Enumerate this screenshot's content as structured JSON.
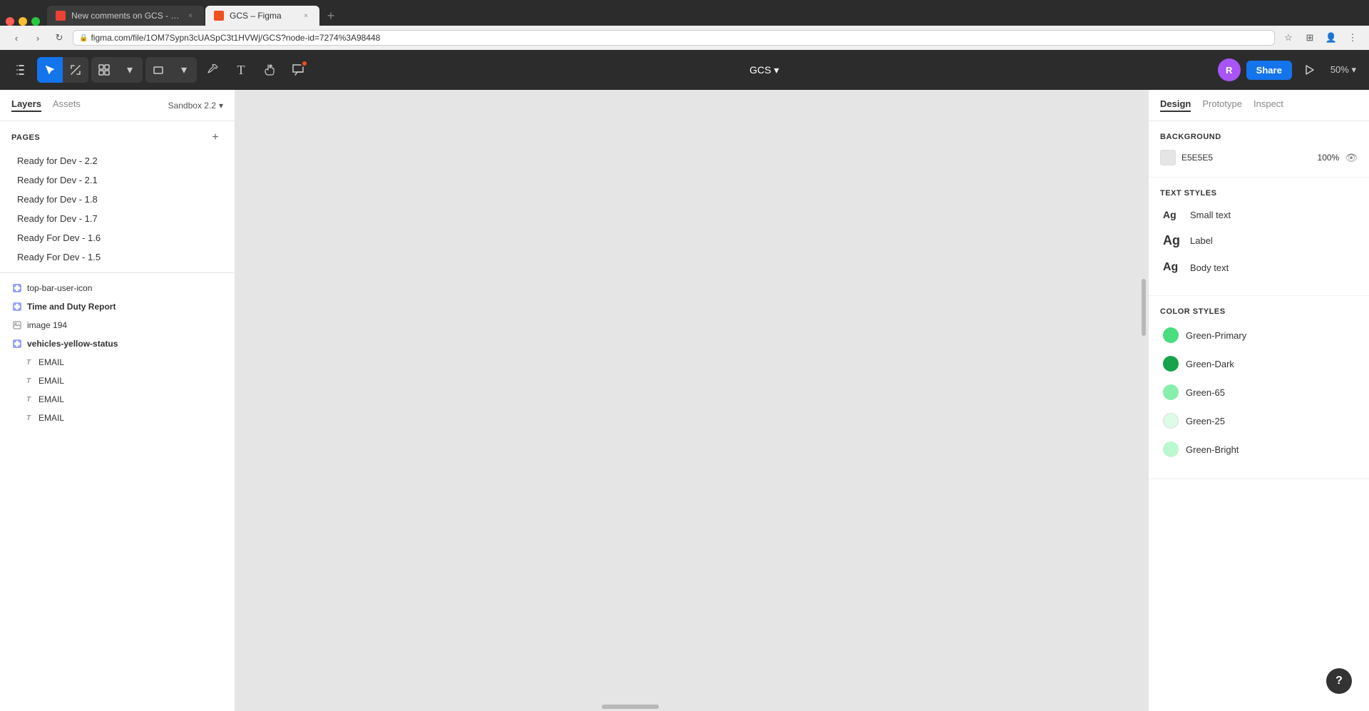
{
  "browser": {
    "tabs": [
      {
        "id": "gmail",
        "favicon_type": "gmail",
        "title": "New comments on GCS - ruth...",
        "active": false,
        "closeable": true
      },
      {
        "id": "figma",
        "favicon_type": "figma",
        "title": "GCS – Figma",
        "active": true,
        "closeable": true
      }
    ],
    "address": "figma.com/file/1OM7Sypn3cUASpC3t1HVWj/GCS?node-id=7274%3A98448",
    "address_lock": "🔒"
  },
  "toolbar": {
    "menu_icon": "≡",
    "project_name": "GCS",
    "chevron": "▾",
    "share_label": "Share",
    "zoom": "50%",
    "avatar_initials": "R",
    "notification_count": "1"
  },
  "left_panel": {
    "tabs": [
      {
        "id": "layers",
        "label": "Layers",
        "active": true
      },
      {
        "id": "assets",
        "label": "Assets",
        "active": false
      }
    ],
    "sandbox_label": "Sandbox 2.2",
    "pages_title": "Pages",
    "pages": [
      {
        "id": "p1",
        "label": "Ready for Dev - 2.2"
      },
      {
        "id": "p2",
        "label": "Ready for Dev - 2.1"
      },
      {
        "id": "p3",
        "label": "Ready for Dev - 1.8"
      },
      {
        "id": "p4",
        "label": "Ready for Dev - 1.7"
      },
      {
        "id": "p5",
        "label": "Ready For Dev - 1.6"
      },
      {
        "id": "p6",
        "label": "Ready For Dev - 1.5"
      }
    ],
    "layers": [
      {
        "id": "l1",
        "icon": "frame",
        "name": "top-bar-user-icon",
        "indent": false,
        "bold": false
      },
      {
        "id": "l2",
        "icon": "frame",
        "name": "Time and Duty Report",
        "indent": false,
        "bold": true
      },
      {
        "id": "l3",
        "icon": "image",
        "name": "image 194",
        "indent": false,
        "bold": false
      },
      {
        "id": "l4",
        "icon": "frame",
        "name": "vehicles-yellow-status",
        "indent": false,
        "bold": true
      },
      {
        "id": "l5",
        "icon": "text",
        "name": "EMAIL",
        "indent": true,
        "bold": false
      },
      {
        "id": "l6",
        "icon": "text",
        "name": "EMAIL",
        "indent": true,
        "bold": false
      },
      {
        "id": "l7",
        "icon": "text",
        "name": "EMAIL",
        "indent": true,
        "bold": false
      },
      {
        "id": "l8",
        "icon": "text",
        "name": "EMAIL",
        "indent": true,
        "bold": false
      }
    ]
  },
  "right_panel": {
    "tabs": [
      {
        "id": "design",
        "label": "Design",
        "active": true
      },
      {
        "id": "prototype",
        "label": "Prototype",
        "active": false
      },
      {
        "id": "inspect",
        "label": "Inspect",
        "active": false
      }
    ],
    "background": {
      "title": "Background",
      "color_hex": "E5E5E5",
      "color_value": "#E5E5E5",
      "opacity": "100%"
    },
    "text_styles": {
      "title": "Text Styles",
      "items": [
        {
          "id": "ts1",
          "ag_label": "Ag",
          "name": "Small text",
          "size": "small"
        },
        {
          "id": "ts2",
          "ag_label": "Ag",
          "name": "Label",
          "size": "label"
        },
        {
          "id": "ts3",
          "ag_label": "Ag",
          "name": "Body text",
          "size": "body"
        }
      ]
    },
    "color_styles": {
      "title": "Color Styles",
      "items": [
        {
          "id": "cs1",
          "name": "Green-Primary",
          "color": "#4ade80"
        },
        {
          "id": "cs2",
          "name": "Green-Dark",
          "color": "#16a34a"
        },
        {
          "id": "cs3",
          "name": "Green-65",
          "color": "#86efac"
        },
        {
          "id": "cs4",
          "name": "Green-25",
          "color": "#dcfce7"
        },
        {
          "id": "cs5",
          "name": "Green-Bright",
          "color": "#bbf7d0"
        }
      ]
    }
  },
  "help": {
    "label": "?"
  }
}
